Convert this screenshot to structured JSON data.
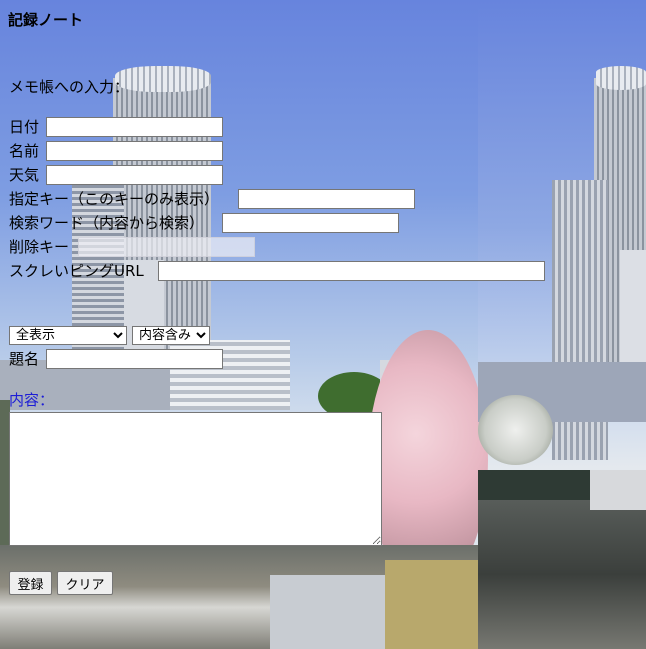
{
  "title": "記録ノート",
  "section_label": "メモ帳への入力：",
  "fields": {
    "date_label": "日付",
    "name_label": "名前",
    "weather_label": "天気",
    "key_label": "指定キー（このキーのみ表示）",
    "search_label": "検索ワード（内容から検索）",
    "delete_label": "削除キー",
    "scraping_label": "スクレいピングURL",
    "subject_label": "題名",
    "content_label": "内容："
  },
  "selects": {
    "display_mode": "全表示",
    "match_mode": "内容含み"
  },
  "buttons": {
    "register": "登録",
    "clear": "クリア"
  }
}
